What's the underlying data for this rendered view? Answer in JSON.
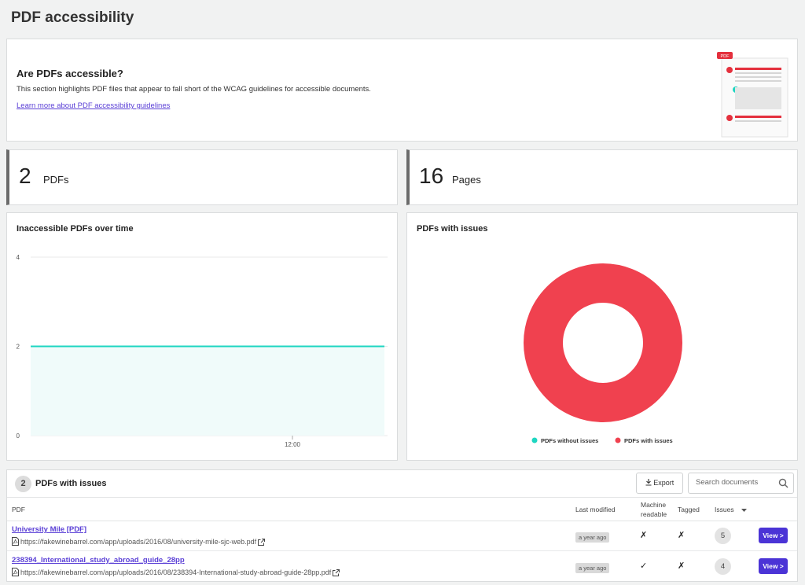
{
  "page": {
    "title": "PDF accessibility"
  },
  "intro": {
    "heading": "Are PDFs accessible?",
    "description": "This section highlights PDF files that appear to fall short of the WCAG guidelines for accessible documents.",
    "link": "Learn more about PDF accessibility guidelines",
    "illustration_badge": "PDF"
  },
  "stats": [
    {
      "value": "2",
      "label": "PDFs"
    },
    {
      "value": "16",
      "label": "Pages"
    }
  ],
  "colors": {
    "accent": "#5a3fd6",
    "button": "#4b34d6",
    "teal": "#1ed6c1",
    "red": "#f0414f"
  },
  "chart_data": [
    {
      "type": "area",
      "title": "Inaccessible PDFs over time",
      "x_ticks": [
        "12:00"
      ],
      "y_ticks": [
        0,
        2,
        4
      ],
      "ylim": [
        0,
        4
      ],
      "series": [
        {
          "values": [
            2,
            2
          ]
        }
      ],
      "grid": true
    },
    {
      "type": "pie",
      "title": "PDFs with issues",
      "donut": true,
      "slices": [
        {
          "label": "PDFs without issues",
          "value": 0,
          "color": "#1ed6c1"
        },
        {
          "label": "PDFs with issues",
          "value": 2,
          "color": "#f0414f"
        }
      ],
      "legend": "bottom"
    }
  ],
  "table": {
    "count": "2",
    "title": "PDFs with issues",
    "export_label": "Export",
    "search_placeholder": "Search documents",
    "columns": {
      "pdf": "PDF",
      "last_modified": "Last modified",
      "machine_readable_1": "Machine",
      "machine_readable_2": "readable",
      "tagged": "Tagged",
      "issues": "Issues"
    },
    "rows": [
      {
        "name": "University Mile [PDF]",
        "url": "https://fakewinebarrel.com/app/uploads/2016/08/university-mile-sjc-web.pdf",
        "modified": "a year ago",
        "machine_readable": "✗",
        "tagged": "✗",
        "issues": "5",
        "action": "View >"
      },
      {
        "name": "238394_International_study_abroad_guide_28pp",
        "url": "https://fakewinebarrel.com/app/uploads/2016/08/238394-International-study-abroad-guide-28pp.pdf",
        "modified": "a year ago",
        "machine_readable": "✓",
        "tagged": "✗",
        "issues": "4",
        "action": "View >"
      }
    ]
  }
}
